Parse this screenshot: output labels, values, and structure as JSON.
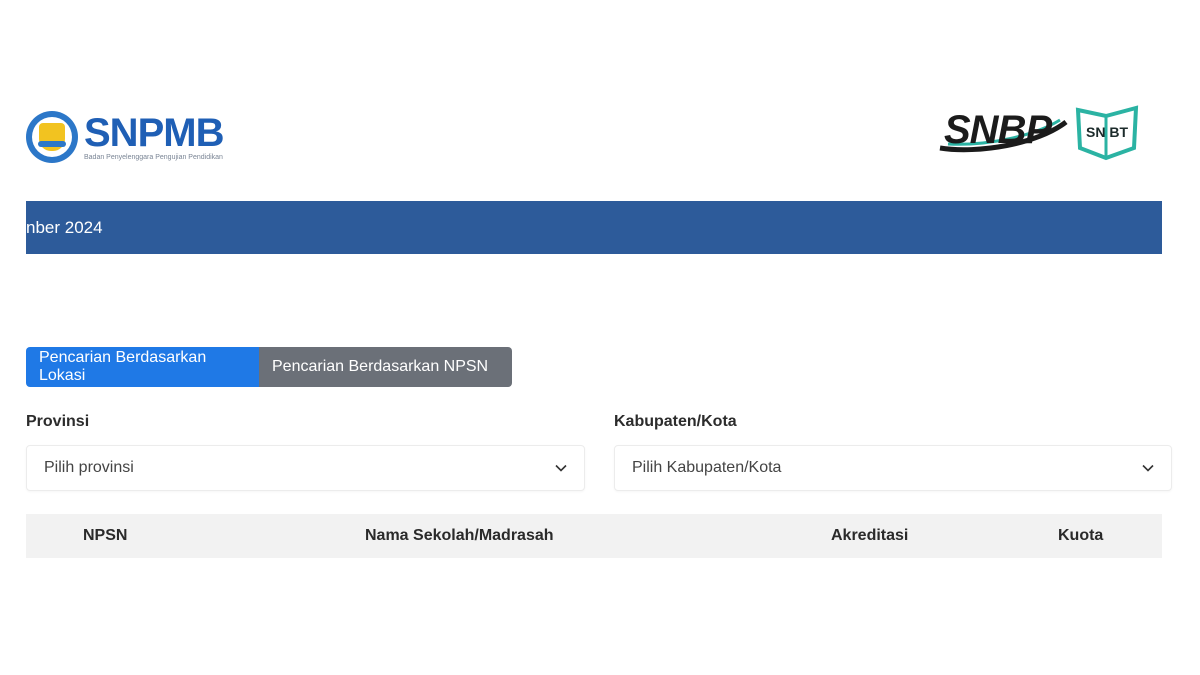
{
  "header": {
    "left_logo_title": "SNPMB",
    "left_logo_subtitle": "Badan Penyelenggara Pengujian Pendidikan",
    "right_logo_snbp": "SNBP",
    "right_logo_snbt": "SN BT"
  },
  "banner": {
    "text": "nber 2024"
  },
  "tabs": [
    {
      "label": "Pencarian Berdasarkan Lokasi",
      "active": true
    },
    {
      "label": "Pencarian Berdasarkan NPSN",
      "active": false
    }
  ],
  "filters": {
    "provinsi_label": "Provinsi",
    "provinsi_placeholder": "Pilih provinsi",
    "kabupaten_label": "Kabupaten/Kota",
    "kabupaten_placeholder": "Pilih Kabupaten/Kota"
  },
  "table": {
    "columns": [
      "NPSN",
      "Nama Sekolah/Madrasah",
      "Akreditasi",
      "Kuota"
    ]
  },
  "colors": {
    "banner": "#2d5b9a",
    "tab_active": "#1f79e6",
    "tab_inactive": "#6b7078",
    "brand_blue": "#1f5fb5",
    "snbt_teal": "#2bb3a3"
  },
  "icons": [
    "tut-wuri-handayani-emblem-icon",
    "chevron-down-icon"
  ]
}
